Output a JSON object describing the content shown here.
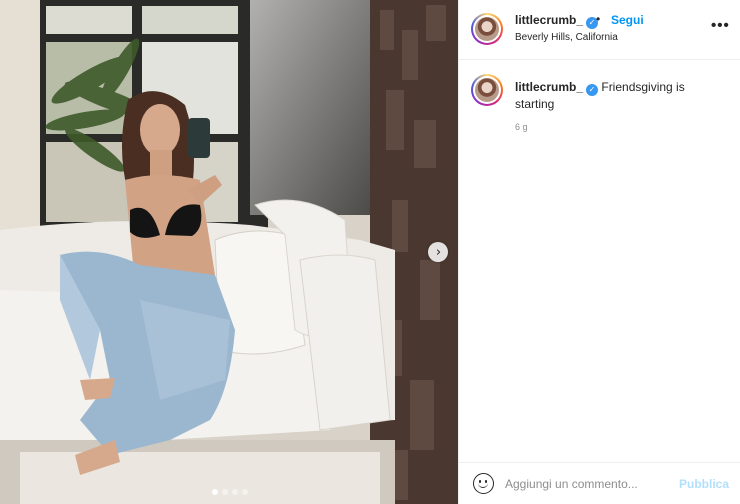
{
  "post": {
    "username": "littlecrumb_",
    "separator": "•",
    "follow_label": "Segui",
    "location": "Beverly Hills, California",
    "more_icon": "more-horizontal-icon",
    "caption_username": "littlecrumb_",
    "caption_text": "Friendsgiving is starting",
    "time_ago": "6 g",
    "verified_icon": "verified-badge-icon"
  },
  "carousel": {
    "next_icon": "chevron-right-icon",
    "slide_count": 4,
    "active_slide": 1
  },
  "comment_box": {
    "emoji_icon": "emoji-icon",
    "placeholder": "Aggiungi un commento...",
    "value": "",
    "publish_label": "Pubblica"
  },
  "colors": {
    "accent": "#0095f6",
    "publish_disabled": "#b2dffc",
    "verified": "#3897f0",
    "muted_text": "#8e8e8e"
  }
}
